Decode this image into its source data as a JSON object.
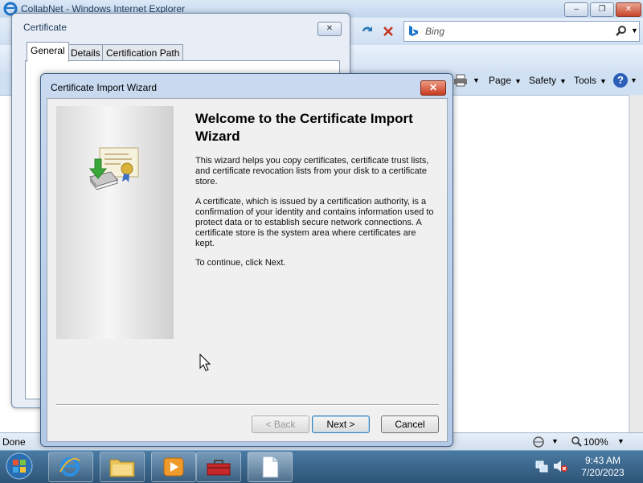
{
  "ie": {
    "title": "CollabNet - Windows Internet Explorer",
    "search_placeholder": "Bing",
    "commands": {
      "page": "Page",
      "safety": "Safety",
      "tools": "Tools"
    },
    "status_text": "Done",
    "zoom": "100%"
  },
  "certificate_dialog": {
    "title": "Certificate",
    "tabs": [
      "General",
      "Details",
      "Certification Path"
    ]
  },
  "wizard": {
    "title": "Certificate Import Wizard",
    "heading": "Welcome to the Certificate Import Wizard",
    "paragraphs": [
      "This wizard helps you copy certificates, certificate trust lists, and certificate revocation lists from your disk to a certificate store.",
      "A certificate, which is issued by a certification authority, is a confirmation of your identity and contains information used to protect data or to establish secure network connections. A certificate store is the system area where certificates are kept.",
      "To continue, click Next."
    ],
    "buttons": {
      "back": "< Back",
      "next": "Next >",
      "cancel": "Cancel"
    }
  },
  "taskbar": {
    "time": "9:43 AM",
    "date": "7/20/2023"
  },
  "colors": {
    "accent": "#1e395b",
    "close_red": "#c63a20"
  }
}
